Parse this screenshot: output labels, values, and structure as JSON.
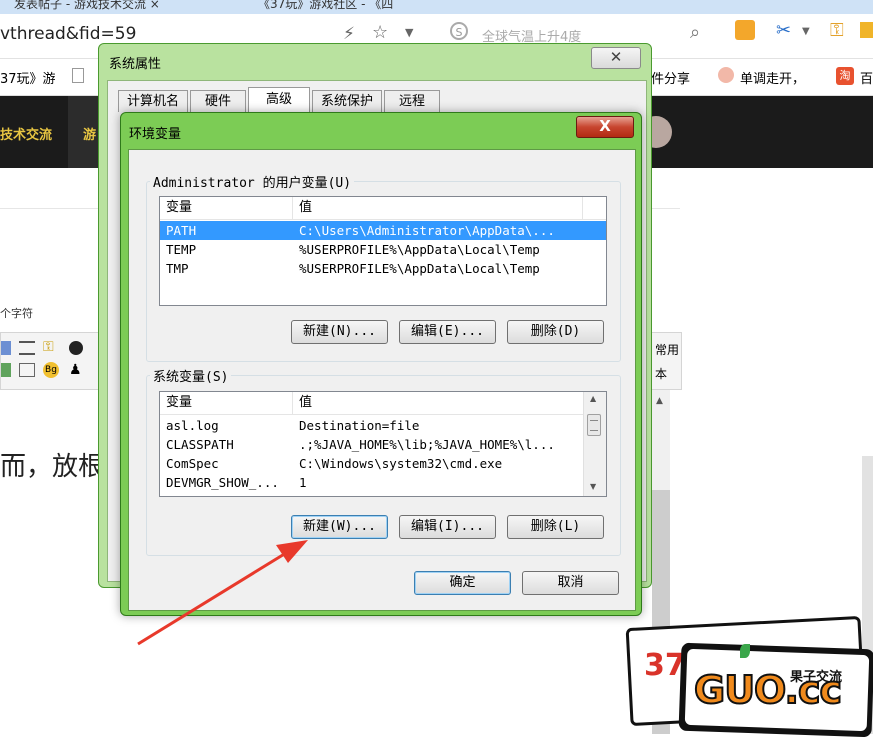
{
  "browser": {
    "tabs": [
      "发表帖子 - 游戏技术交流",
      "《37玩》游戏社区 - 《四"
    ],
    "url": "vthread&fid=59",
    "search_placeholder": "全球气温上升4度",
    "bookmarks": [
      "37玩》游",
      "件分享",
      "单调走开，",
      "百"
    ]
  },
  "site": {
    "nav": [
      "技术交流",
      "游"
    ]
  },
  "page": {
    "hint": "个字符",
    "toolbar_right_1": "常用",
    "toolbar_right_2": "本",
    "body_text": "而，放根"
  },
  "sysprops": {
    "title": "系统属性",
    "tabs": [
      "计算机名",
      "硬件",
      "高级",
      "系统保护",
      "远程"
    ],
    "active_tab": "高级"
  },
  "envvars": {
    "title": "环境变量",
    "close_label": "X",
    "user_group_label": "Administrator 的用户变量(U)",
    "columns": [
      "变量",
      "值"
    ],
    "user_vars": [
      {
        "name": "PATH",
        "value": "C:\\Users\\Administrator\\AppData\\..."
      },
      {
        "name": "TEMP",
        "value": "%USERPROFILE%\\AppData\\Local\\Temp"
      },
      {
        "name": "TMP",
        "value": "%USERPROFILE%\\AppData\\Local\\Temp"
      }
    ],
    "user_buttons": {
      "new": "新建(N)...",
      "edit": "编辑(E)...",
      "delete": "删除(D)"
    },
    "system_group_label": "系统变量(S)",
    "system_vars": [
      {
        "name": "asl.log",
        "value": "Destination=file"
      },
      {
        "name": "CLASSPATH",
        "value": ".;%JAVA_HOME%\\lib;%JAVA_HOME%\\l..."
      },
      {
        "name": "ComSpec",
        "value": "C:\\Windows\\system32\\cmd.exe"
      },
      {
        "name": "DEVMGR_SHOW_...",
        "value": "1"
      }
    ],
    "system_buttons": {
      "new": "新建(W)...",
      "edit": "编辑(I)...",
      "delete": "删除(L)"
    },
    "ok": "确定",
    "cancel": "取消"
  },
  "watermark": {
    "brand": "GUO.cc",
    "tagline": "果子交流",
    "num": "37"
  },
  "colors": {
    "selection": "#3399ff",
    "dialog_frame": "#4caf2e",
    "annotation_arrow": "#e8392b"
  }
}
